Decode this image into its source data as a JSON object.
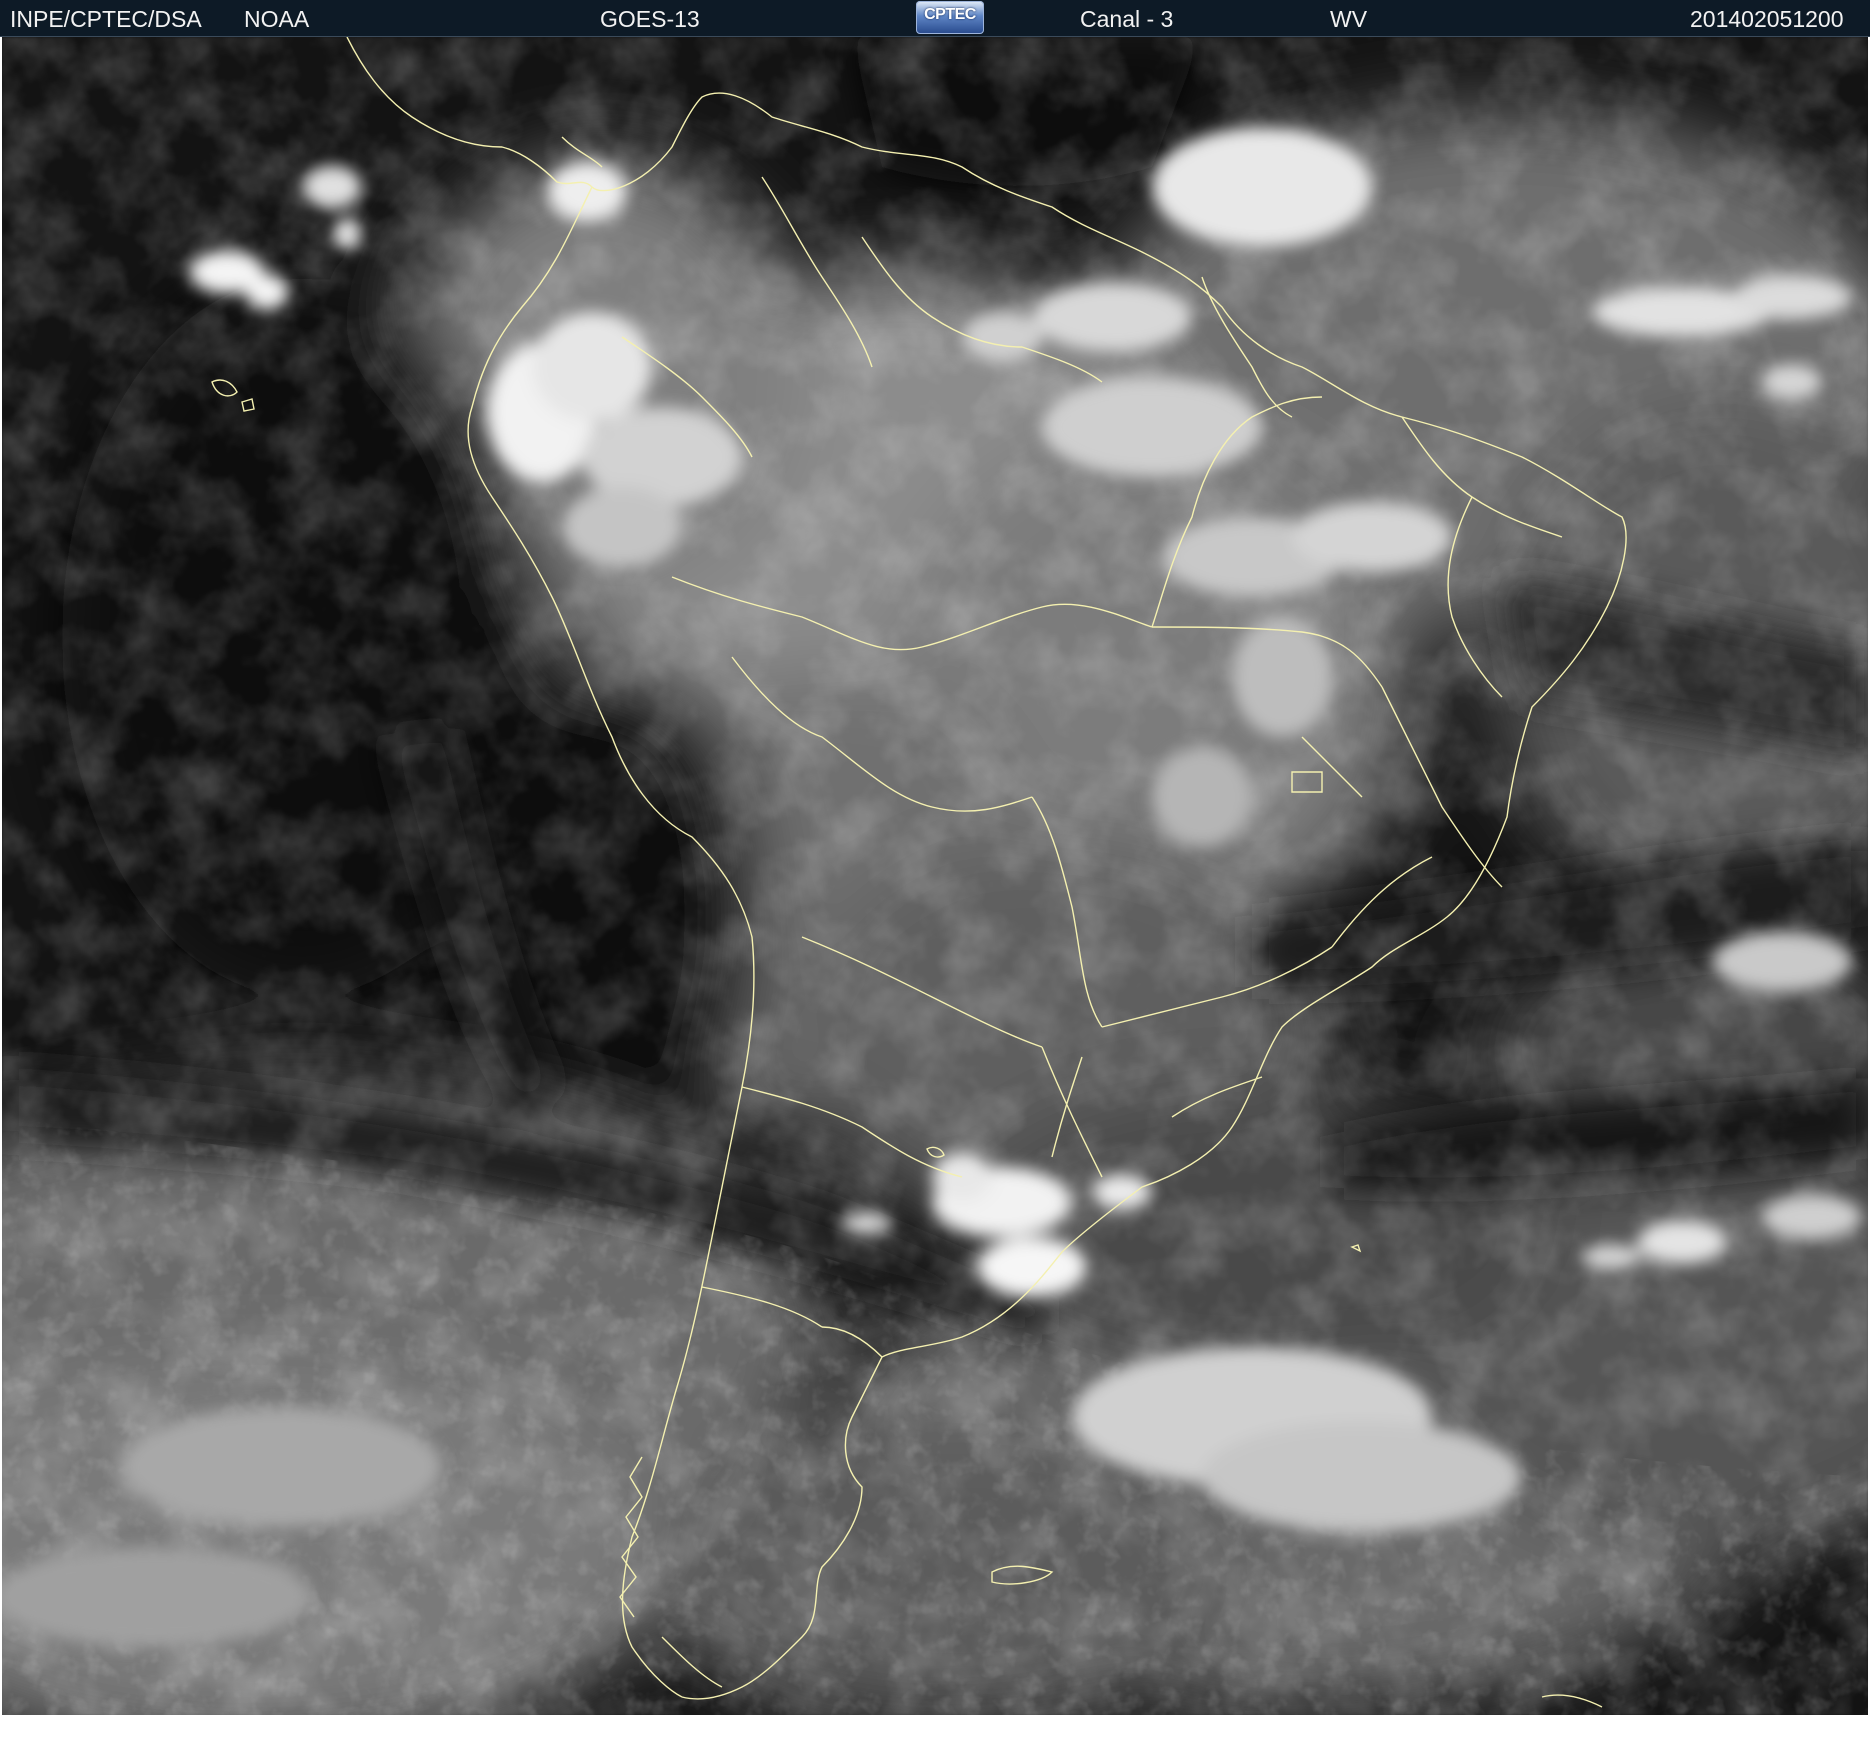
{
  "header": {
    "source": "INPE/CPTEC/DSA",
    "agency": "NOAA",
    "satellite": "GOES-13",
    "logo_text": "CPTEC",
    "channel": "Canal - 3",
    "product": "WV",
    "timestamp": "201402051200"
  },
  "imagery": {
    "description_type": "water-vapor satellite image",
    "coastline_color": "#f4f0b0"
  }
}
